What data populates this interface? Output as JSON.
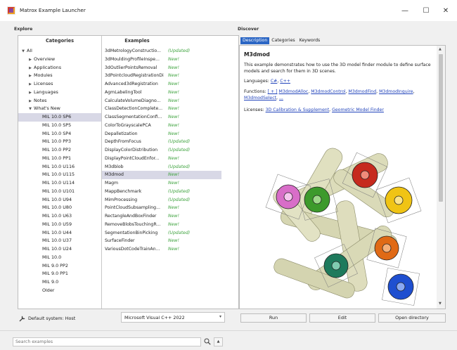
{
  "window": {
    "title": "Matrox Example Launcher",
    "minimize": "—",
    "maximize": "☐",
    "close": "✕"
  },
  "explore": {
    "label": "Explore",
    "categories_header": "Categories",
    "examples_header": "Examples",
    "tree": [
      {
        "label": "All",
        "arrow": "▼",
        "indent": 0
      },
      {
        "label": "Overview",
        "arrow": "▶",
        "indent": 1
      },
      {
        "label": "Applications",
        "arrow": "▶",
        "indent": 1
      },
      {
        "label": "Modules",
        "arrow": "▶",
        "indent": 1
      },
      {
        "label": "Licenses",
        "arrow": "▶",
        "indent": 1
      },
      {
        "label": "Languages",
        "arrow": "▶",
        "indent": 1
      },
      {
        "label": "Notes",
        "arrow": "▶",
        "indent": 1
      },
      {
        "label": "What's New",
        "arrow": "▼",
        "indent": 1
      },
      {
        "label": "MIL 10.0 SP6",
        "arrow": "",
        "indent": 2,
        "selected": true
      },
      {
        "label": "MIL 10.0 SP5",
        "arrow": "",
        "indent": 2
      },
      {
        "label": "MIL 10.0 SP4",
        "arrow": "",
        "indent": 2
      },
      {
        "label": "MIL 10.0 PP3",
        "arrow": "",
        "indent": 2
      },
      {
        "label": "MIL 10.0 PP2",
        "arrow": "",
        "indent": 2
      },
      {
        "label": "MIL 10.0 PP1",
        "arrow": "",
        "indent": 2
      },
      {
        "label": "MIL 10.0 U116",
        "arrow": "",
        "indent": 2
      },
      {
        "label": "MIL 10.0 U115",
        "arrow": "",
        "indent": 2
      },
      {
        "label": "MIL 10.0 U114",
        "arrow": "",
        "indent": 2
      },
      {
        "label": "MIL 10.0 U101",
        "arrow": "",
        "indent": 2
      },
      {
        "label": "MIL 10.0 U94",
        "arrow": "",
        "indent": 2
      },
      {
        "label": "MIL 10.0 U80",
        "arrow": "",
        "indent": 2
      },
      {
        "label": "MIL 10.0 U63",
        "arrow": "",
        "indent": 2
      },
      {
        "label": "MIL 10.0 U59",
        "arrow": "",
        "indent": 2
      },
      {
        "label": "MIL 10.0 U44",
        "arrow": "",
        "indent": 2
      },
      {
        "label": "MIL 10.0 U37",
        "arrow": "",
        "indent": 2
      },
      {
        "label": "MIL 10.0 U24",
        "arrow": "",
        "indent": 2
      },
      {
        "label": "MIL 10.0",
        "arrow": "",
        "indent": 2
      },
      {
        "label": "MIL 9.0 PP2",
        "arrow": "",
        "indent": 2
      },
      {
        "label": "MIL 9.0 PP1",
        "arrow": "",
        "indent": 2
      },
      {
        "label": "MIL 9.0",
        "arrow": "",
        "indent": 2
      },
      {
        "label": "Older",
        "arrow": "",
        "indent": 2
      }
    ],
    "examples": [
      {
        "name": "3dMetrologyConstructio...",
        "status": "(Updated)"
      },
      {
        "name": "3dMouldingProfileInspe...",
        "status": "New!"
      },
      {
        "name": "3dOutlierPointsRemoval",
        "status": "New!"
      },
      {
        "name": "3dPointcloudRegistrationDi...",
        "status": "New!"
      },
      {
        "name": "Advanced3dRegistration",
        "status": "New!"
      },
      {
        "name": "AgmLabelingTool",
        "status": "New!"
      },
      {
        "name": "CalculateVolumeDiagno...",
        "status": "New!"
      },
      {
        "name": "ClassDetectionComplete...",
        "status": "New!"
      },
      {
        "name": "ClassSegmentationConfi...",
        "status": "New!"
      },
      {
        "name": "ColorToGrayscalePCA",
        "status": "New!"
      },
      {
        "name": "Depalletization",
        "status": "New!"
      },
      {
        "name": "DepthFromFocus",
        "status": "(Updated)"
      },
      {
        "name": "DisplayColorDistribution",
        "status": "(Updated)"
      },
      {
        "name": "DisplayPointCloudEnfor...",
        "status": "New!"
      },
      {
        "name": "M3dblob",
        "status": "(Updated)"
      },
      {
        "name": "M3dmod",
        "status": "New!",
        "selected": true
      },
      {
        "name": "Magm",
        "status": "New!"
      },
      {
        "name": "MappBenchmark",
        "status": "(Updated)"
      },
      {
        "name": "MimProcessing",
        "status": "(Updated)"
      },
      {
        "name": "PointCloudSubsampling...",
        "status": "New!"
      },
      {
        "name": "RectangleAndBoxFinder",
        "status": "New!"
      },
      {
        "name": "RemoveBlobsTouchingR...",
        "status": "New!"
      },
      {
        "name": "SegmentationBinPicking",
        "status": "(Updated)"
      },
      {
        "name": "SurfaceFinder",
        "status": "New!"
      },
      {
        "name": "VariousDotCodeTrainAn...",
        "status": "New!"
      }
    ],
    "default_system": "Default system: Host",
    "compiler": "Microsoft Visual C++ 2022"
  },
  "discover": {
    "label": "Discover",
    "tabs": [
      "Description",
      "Categories",
      "Keywords"
    ],
    "title": "M3dmod",
    "description": "This example demonstrates how to use the 3D model finder module to define surface models and search for them in 3D scenes.",
    "languages_label": "Languages:",
    "languages": [
      "C#",
      "C++"
    ],
    "functions_label": "Functions:",
    "functions_prefix": "[ + ]",
    "functions": [
      "M3dmodAlloc",
      "M3dmodControl",
      "M3dmodFind",
      "M3dmodInquire",
      "M3dmodSelect",
      "..."
    ],
    "licenses_label": "Licenses:",
    "licenses": [
      "3D Calibration & Supplement",
      "Geometric Model Finder"
    ],
    "buttons": {
      "run": "Run",
      "edit": "Edit",
      "open_directory": "Open directory"
    }
  },
  "search": {
    "placeholder": "Search examples"
  },
  "colors": {
    "accent": "#2b66c4",
    "new": "#3ea33e",
    "link": "#2244bb",
    "selection": "#d8d8e6"
  }
}
